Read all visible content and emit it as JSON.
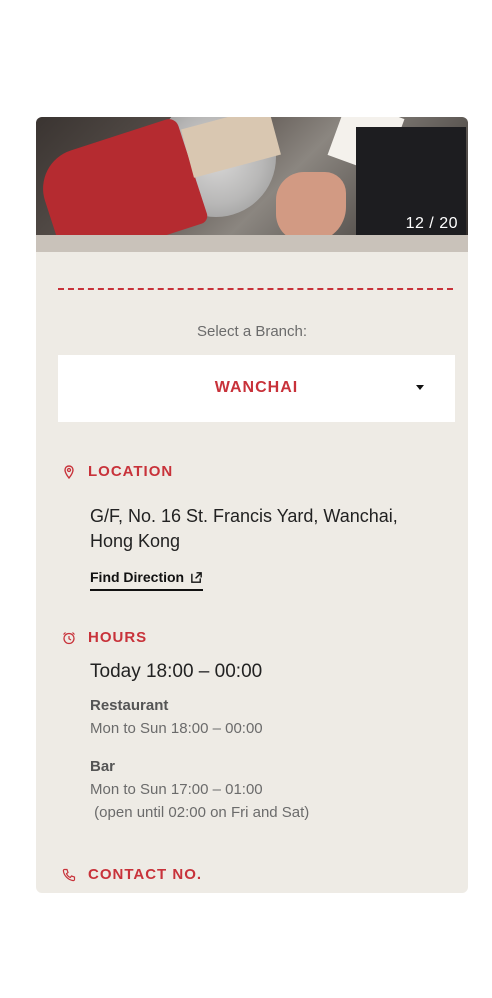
{
  "gallery": {
    "counter": "12 / 20"
  },
  "branch": {
    "label": "Select a Branch:",
    "selected": "WANCHAI"
  },
  "location": {
    "heading": "LOCATION",
    "address_line1": "G/F, No. 16 St. Francis Yard, Wanchai,",
    "address_line2": "Hong Kong",
    "direction_link": "Find Direction"
  },
  "hours": {
    "heading": "HOURS",
    "today": "Today 18:00 – 00:00",
    "restaurant_title": "Restaurant",
    "restaurant_hours": "Mon to Sun 18:00 – 00:00",
    "bar_title": "Bar",
    "bar_hours": "Mon to Sun 17:00 – 01:00",
    "bar_note": " (open until 02:00 on Fri and Sat)"
  },
  "contact": {
    "heading": "CONTACT NO."
  },
  "colors": {
    "accent": "#c8323a",
    "card_bg": "#eeebe5"
  },
  "icons": {
    "location": "map-pin-icon",
    "hours": "alarm-clock-icon",
    "contact": "phone-icon",
    "direction": "external-link-icon",
    "dropdown": "caret-down-icon"
  }
}
